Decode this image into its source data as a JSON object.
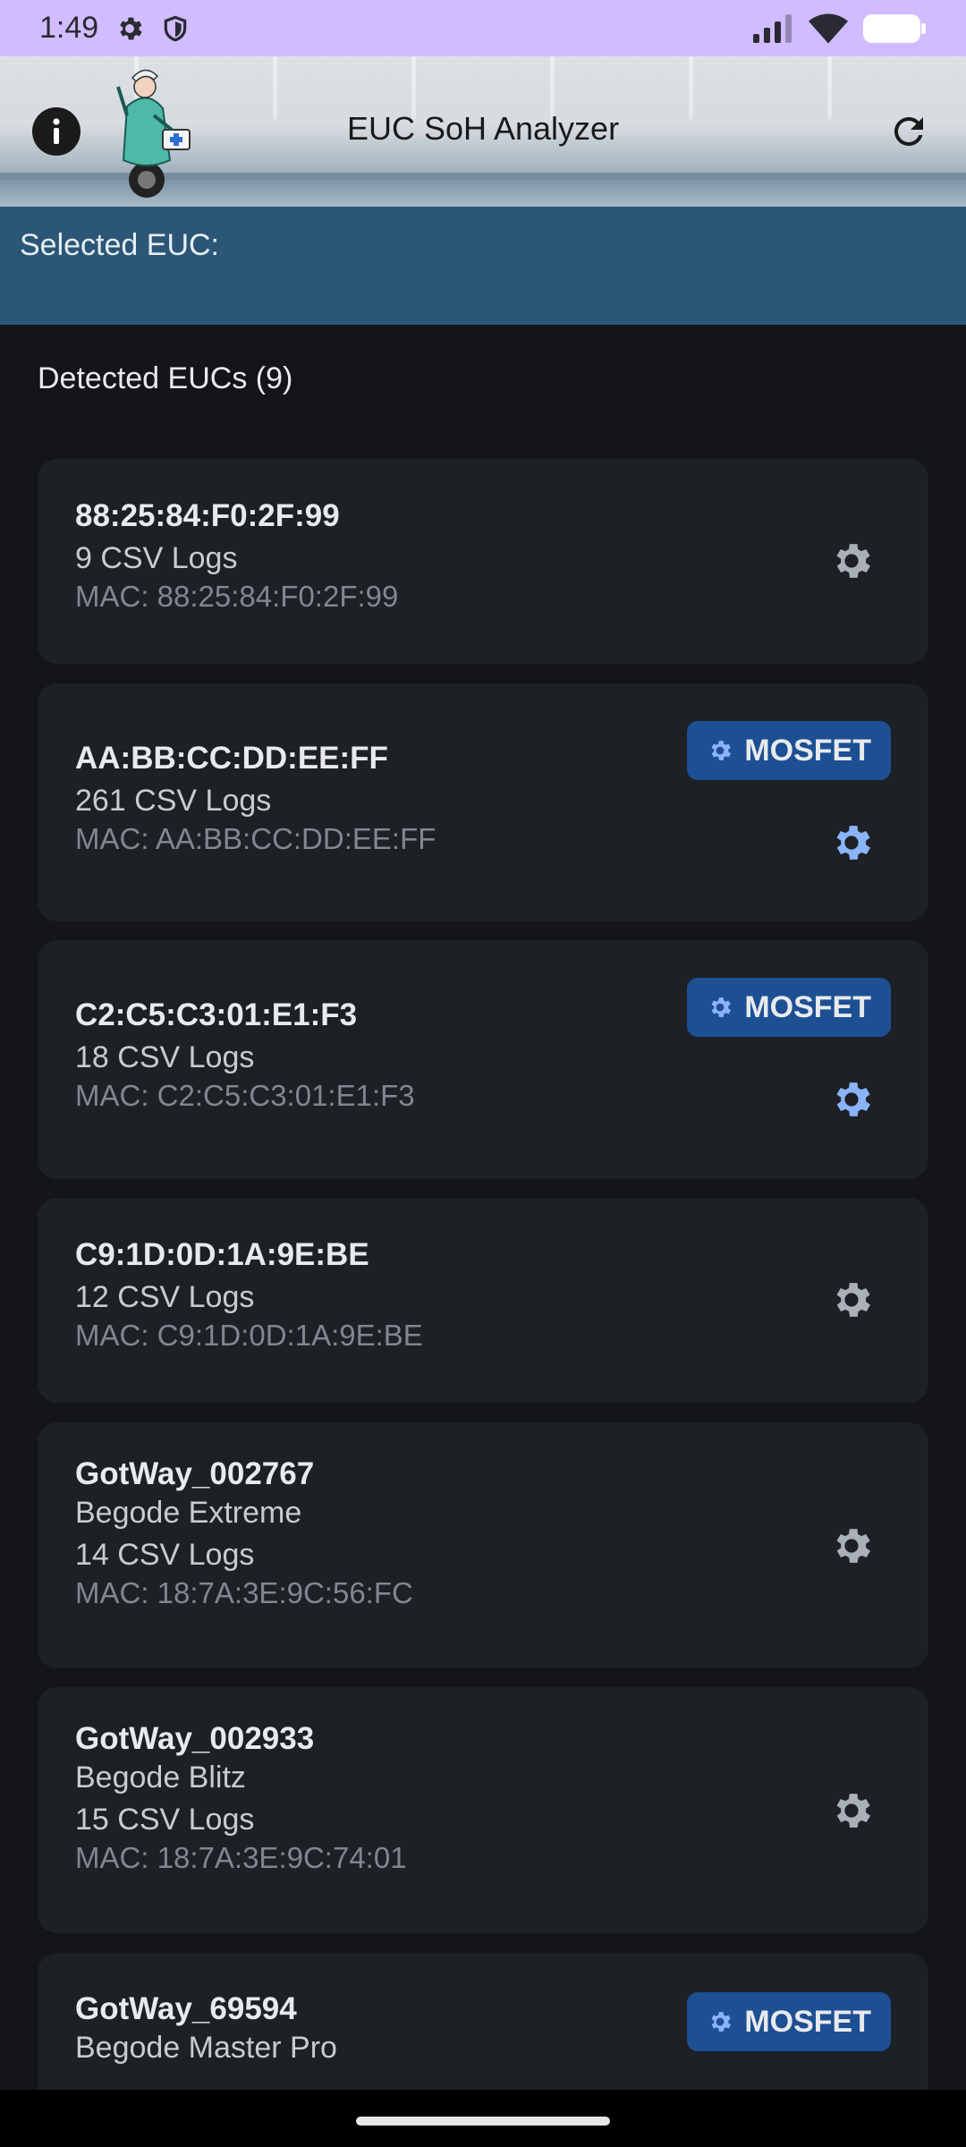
{
  "status": {
    "time": "1:49"
  },
  "header": {
    "title": "EUC SoH Analyzer"
  },
  "selected": {
    "label": "Selected EUC:"
  },
  "list": {
    "title": "Detected EUCs (9)",
    "mosfet_label": "MOSFET",
    "items": [
      {
        "name": "88:25:84:F0:2F:99",
        "model": "",
        "logs": "9 CSV Logs",
        "mac": "MAC: 88:25:84:F0:2F:99",
        "mosfet": false
      },
      {
        "name": "AA:BB:CC:DD:EE:FF",
        "model": "",
        "logs": "261 CSV Logs",
        "mac": "MAC: AA:BB:CC:DD:EE:FF",
        "mosfet": true
      },
      {
        "name": "C2:C5:C3:01:E1:F3",
        "model": "",
        "logs": "18 CSV Logs",
        "mac": "MAC: C2:C5:C3:01:E1:F3",
        "mosfet": true
      },
      {
        "name": "C9:1D:0D:1A:9E:BE",
        "model": "",
        "logs": "12 CSV Logs",
        "mac": "MAC: C9:1D:0D:1A:9E:BE",
        "mosfet": false
      },
      {
        "name": "GotWay_002767",
        "model": "Begode Extreme",
        "logs": "14 CSV Logs",
        "mac": "MAC: 18:7A:3E:9C:56:FC",
        "mosfet": false
      },
      {
        "name": "GotWay_002933",
        "model": "Begode Blitz",
        "logs": "15 CSV Logs",
        "mac": "MAC: 18:7A:3E:9C:74:01",
        "mosfet": false
      },
      {
        "name": "GotWay_69594",
        "model": "Begode Master Pro",
        "logs": "",
        "mac": "",
        "mosfet": true
      }
    ]
  },
  "colors": {
    "accent": "#1d4f93",
    "selected_bar": "#2c5676",
    "gear_gray": "#a9b0b8",
    "gear_blue": "#8ab4f8",
    "status_bar": "#d0bcff"
  }
}
